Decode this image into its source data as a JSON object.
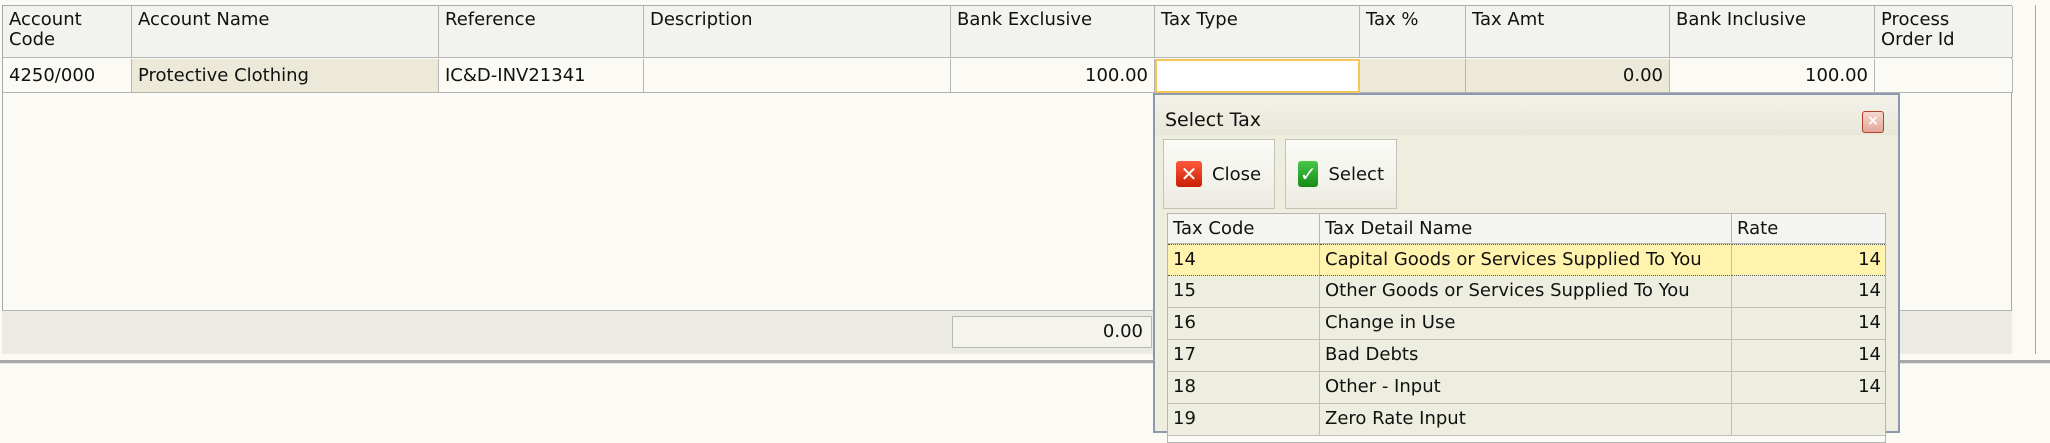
{
  "grid": {
    "headers": {
      "account_code": "Account Code",
      "account_name": "Account Name",
      "reference": "Reference",
      "description": "Description",
      "bank_exclusive": "Bank Exclusive",
      "tax_type": "Tax Type",
      "tax_pct": "Tax %",
      "tax_amt": "Tax Amt",
      "bank_inclusive": "Bank Inclusive",
      "process_order_id": "Process Order Id"
    },
    "row": {
      "account_code": "4250/000",
      "account_name": "Protective Clothing",
      "reference": "IC&D-INV21341",
      "description": "",
      "bank_exclusive": "100.00",
      "tax_type": "",
      "tax_pct": "",
      "tax_amt": "0.00",
      "bank_inclusive": "100.00",
      "process_order_id": ""
    },
    "totals": {
      "bank_exclusive": "0.00"
    }
  },
  "dialog": {
    "title": "Select Tax",
    "close_glyph": "×",
    "buttons": {
      "close_label": "Close",
      "select_label": "Select",
      "close_icon": "close-icon",
      "select_icon": "check-icon"
    },
    "headers": {
      "code": "Tax Code",
      "name": "Tax Detail Name",
      "rate": "Rate"
    },
    "rows": [
      {
        "code": "14",
        "name": "Capital Goods or Services Supplied To You",
        "rate": "14"
      },
      {
        "code": "15",
        "name": "Other Goods or Services Supplied To You",
        "rate": "14"
      },
      {
        "code": "16",
        "name": "Change in Use",
        "rate": "14"
      },
      {
        "code": "17",
        "name": "Bad Debts",
        "rate": "14"
      },
      {
        "code": "18",
        "name": "Other - Input",
        "rate": "14"
      },
      {
        "code": "19",
        "name": "Zero Rate Input",
        "rate": ""
      }
    ]
  },
  "colors": {
    "selected_row": "#fff3ad",
    "edit_border": "#f2c75a",
    "close_red": "#d03010",
    "select_green": "#1f9a22"
  }
}
